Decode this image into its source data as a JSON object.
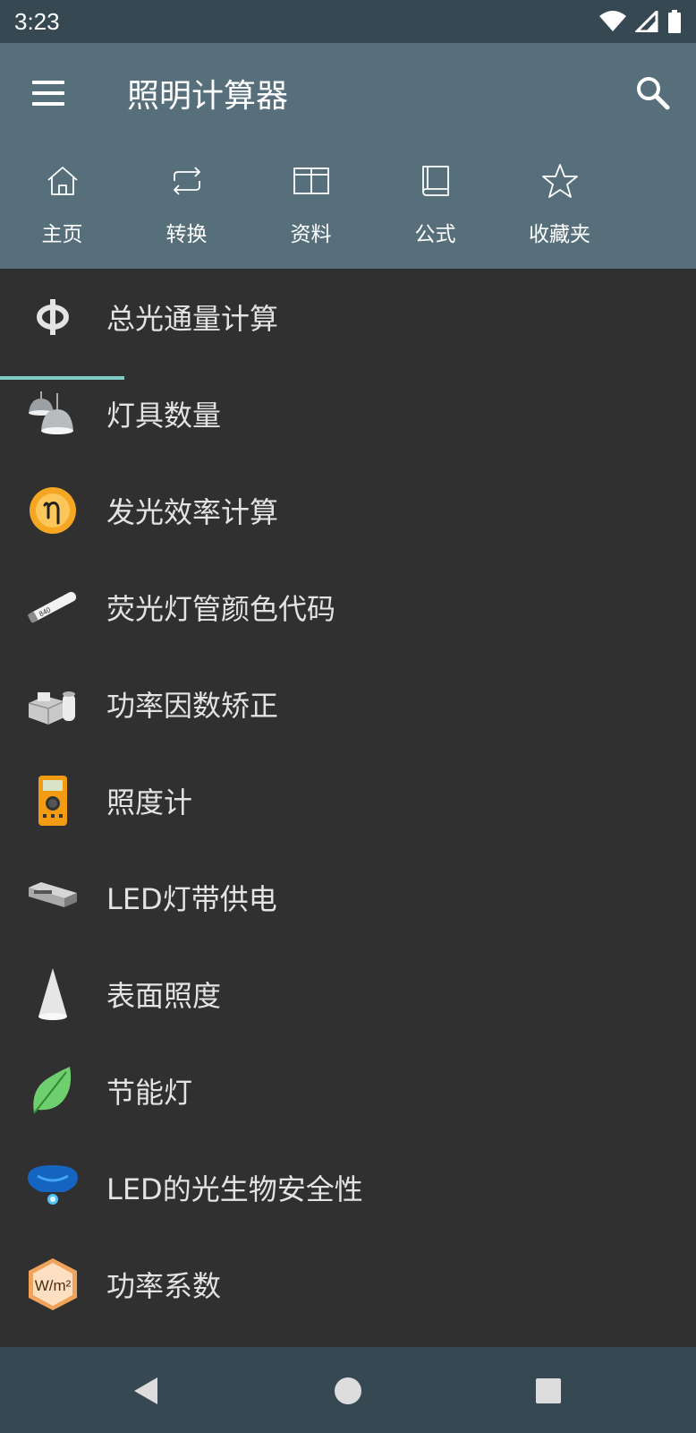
{
  "status_bar": {
    "time": "3:23",
    "icons": [
      "wifi-icon",
      "signal-icon",
      "battery-icon"
    ]
  },
  "app_bar": {
    "title": "照明计算器",
    "menu_icon": "menu-icon",
    "search_icon": "search-icon",
    "background_color": "#566f7b"
  },
  "tabs": [
    {
      "label": "主页",
      "icon": "home-icon",
      "selected": true
    },
    {
      "label": "转换",
      "icon": "repeat-icon",
      "selected": false
    },
    {
      "label": "资料",
      "icon": "table-icon",
      "selected": false
    },
    {
      "label": "公式",
      "icon": "book-icon",
      "selected": false
    },
    {
      "label": "收藏夹",
      "icon": "star-icon",
      "selected": false
    }
  ],
  "accent_color": "#80cbc4",
  "list": {
    "items": [
      {
        "label": "总光通量计算",
        "icon": "phi-icon"
      },
      {
        "label": "灯具数量",
        "icon": "lamps-icon"
      },
      {
        "label": "发光效率计算",
        "icon": "eta-icon"
      },
      {
        "label": "荧光灯管颜色代码",
        "icon": "fluorescent-tube-icon",
        "icon_text": "840"
      },
      {
        "label": "功率因数矫正",
        "icon": "ballast-capacitor-icon"
      },
      {
        "label": "照度计",
        "icon": "lux-meter-icon"
      },
      {
        "label": "LED灯带供电",
        "icon": "power-supply-icon"
      },
      {
        "label": "表面照度",
        "icon": "light-cone-icon"
      },
      {
        "label": "节能灯",
        "icon": "leaf-icon"
      },
      {
        "label": "LED的光生物安全性",
        "icon": "blue-light-icon"
      },
      {
        "label": "功率系数",
        "icon": "wm2-icon",
        "icon_text": "W/m²"
      }
    ]
  },
  "nav_bar": {
    "buttons": [
      "back-icon",
      "home-circle-icon",
      "recents-square-icon"
    ]
  }
}
